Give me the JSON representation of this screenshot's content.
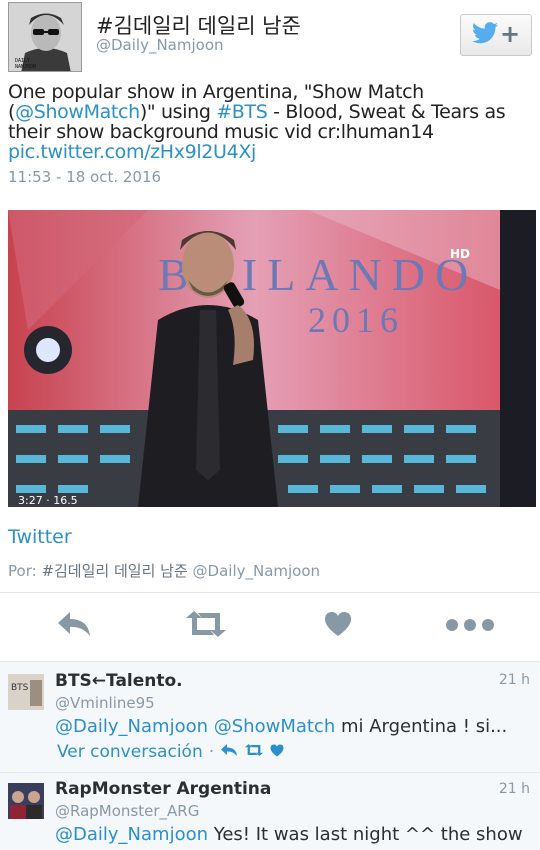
{
  "author": {
    "display_name": "#김데일리 데일리 남준",
    "screen_name": "@Daily_Namjoon",
    "avatar_caption": "DAILY NAMJOON"
  },
  "follow_button": {
    "icon": "twitter-bird-icon",
    "plus": "+"
  },
  "tweet": {
    "t1": "One popular show in Argentina, \"Show Match (",
    "mention_showmatch": "@ShowMatch",
    "t2": ")\" using ",
    "hashtag": "#BTS",
    "t3": " - Blood, Sweat & Tears as their show background music vid cr:lhuman14",
    "link": "pic.twitter.com/zHx9l2U4Xj",
    "timestamp": "11:53 - 18 oct. 2016"
  },
  "media": {
    "backdrop_text": "BAILANDO",
    "year": "2016",
    "channel": "HD",
    "overlay_time": "3:27 · 16.5"
  },
  "card": {
    "source": "Twitter",
    "by_label": "Por:",
    "by_name": "#김데일리 데일리 남준",
    "by_handle": "@Daily_Namjoon"
  },
  "actions": [
    "reply-icon",
    "retweet-icon",
    "like-icon",
    "more-icon"
  ],
  "colors": {
    "link": "#2b8fc9",
    "muted": "#8899a6",
    "icon": "#8899a6",
    "reply_bg": "#f5f8fa"
  },
  "replies": [
    {
      "name": "BTS←Talento.",
      "handle": "@Vminline95",
      "time": "21 h",
      "mention1": "@Daily_Namjoon",
      "mention2": "@ShowMatch",
      "text": " mi Argentina ! si...",
      "conversation": "Ver conversación",
      "avatar_text": "BTS"
    },
    {
      "name": "RapMonster Argentina",
      "handle": "@RapMonster_ARG",
      "time": "21 h",
      "mention1": "@Daily_Namjoon",
      "text": " Yes! It was last night ^^ the show"
    }
  ]
}
